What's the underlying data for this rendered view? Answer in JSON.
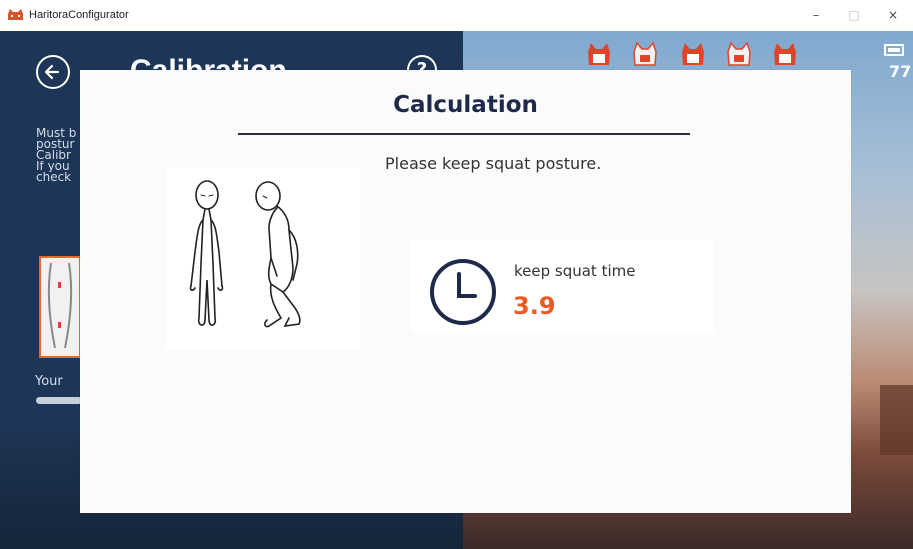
{
  "window": {
    "title": "HaritoraConfigurator",
    "minimize": "–",
    "maximize": "□",
    "close": "×",
    "accent": "#e56a2c"
  },
  "background": {
    "page_title": "Calibration",
    "help": "?",
    "text_lines": [
      "Must b",
      "postur",
      "Calibr",
      "If you",
      "check"
    ],
    "your_label": "Your",
    "battery_value": "77"
  },
  "modal": {
    "title": "Calculation",
    "instruction": "Please keep squat posture.",
    "timer_label": "keep squat time",
    "timer_value": "3.9",
    "timer_color": "#ec5a23"
  },
  "icons": [
    "app-icon",
    "back-arrow-icon",
    "help-icon",
    "avatar-icon",
    "battery-icon",
    "clock-icon"
  ]
}
